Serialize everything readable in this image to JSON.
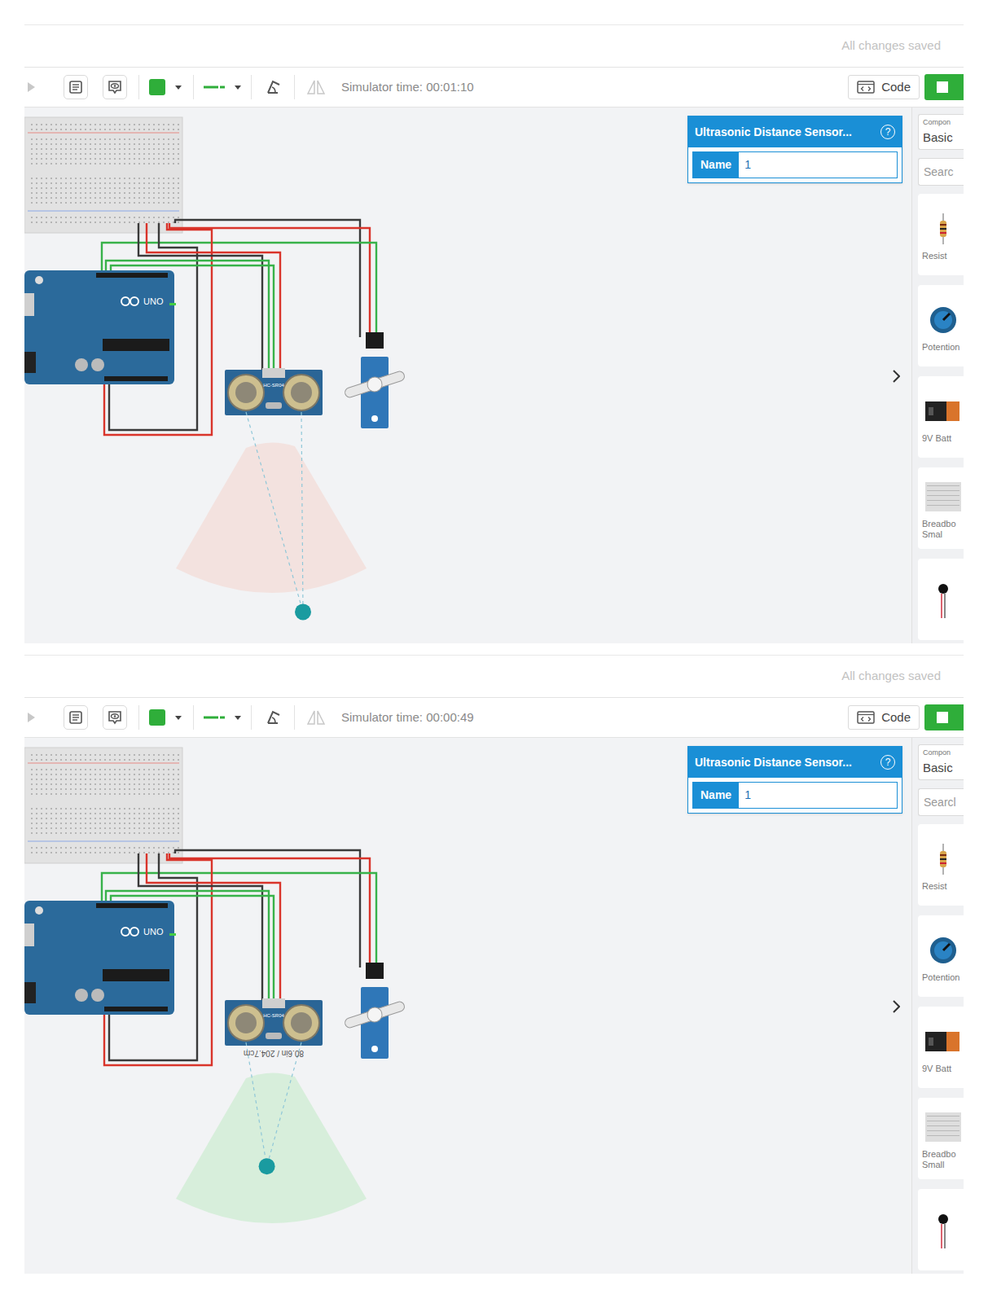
{
  "panels": [
    {
      "save_status": "All changes saved",
      "simulator_time": "Simulator time: 00:01:10",
      "code_button": "Code",
      "inspector": {
        "title": "Ultrasonic Distance Sensor...",
        "help": "?",
        "name_label": "Name",
        "name_value": "1"
      },
      "board_label": "UNO",
      "sensor_label": "HC-SR04",
      "object_in_range": false,
      "target": {
        "level": 0.95
      },
      "sidebar": {
        "category_label": "Compon",
        "category": "Basic",
        "search_placeholder": "Searc",
        "items": [
          {
            "label": "Resist",
            "kind": "resistor"
          },
          {
            "label": "Potention",
            "kind": "potentiometer"
          },
          {
            "label": "9V Batt",
            "kind": "battery"
          },
          {
            "label": "Breadbo Smal",
            "kind": "breadboard"
          },
          {
            "kind": "pin"
          }
        ]
      }
    },
    {
      "save_status": "All changes saved",
      "simulator_time": "Simulator time: 00:00:49",
      "code_button": "Code",
      "inspector": {
        "title": "Ultrasonic Distance Sensor...",
        "help": "?",
        "name_label": "Name",
        "name_value": "1"
      },
      "board_label": "UNO",
      "sensor_label": "HC-SR04",
      "reading": "80.6in / 204.7cm",
      "object_in_range": true,
      "target": {
        "level": 0.58
      },
      "sidebar": {
        "category_label": "Compon",
        "category": "Basic",
        "search_placeholder": "Searcl",
        "items": [
          {
            "label": "Resist",
            "kind": "resistor"
          },
          {
            "label": "Potention",
            "kind": "potentiometer"
          },
          {
            "label": "9V Batt",
            "kind": "battery"
          },
          {
            "label": "Breadbo Small",
            "kind": "breadboard"
          },
          {
            "kind": "pin"
          }
        ]
      }
    }
  ]
}
